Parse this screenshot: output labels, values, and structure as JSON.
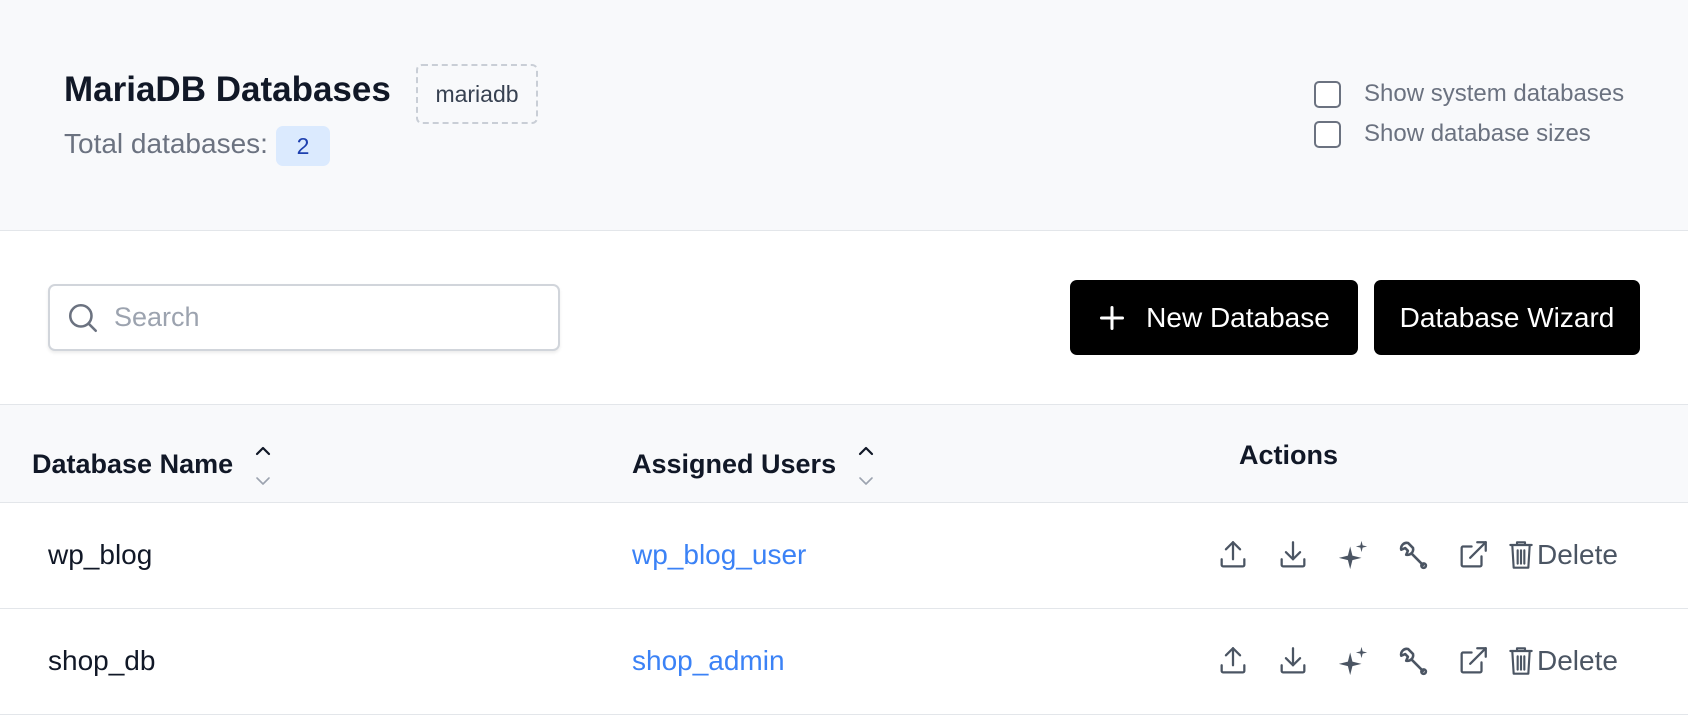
{
  "header": {
    "title": "MariaDB Databases",
    "engine_badge": "mariadb",
    "total_label": "Total databases:",
    "total_count": "2",
    "options": [
      {
        "label": "Show system databases",
        "checked": false
      },
      {
        "label": "Show database sizes",
        "checked": false
      }
    ]
  },
  "toolbar": {
    "search_placeholder": "Search",
    "search_value": "",
    "new_database_label": "New Database",
    "wizard_label": "Database Wizard"
  },
  "table": {
    "columns": [
      "Database Name",
      "Assigned Users",
      "Actions"
    ],
    "rows": [
      {
        "name": "wp_blog",
        "user": "wp_blog_user"
      },
      {
        "name": "shop_db",
        "user": "shop_admin"
      }
    ],
    "delete_label": "Delete"
  },
  "icons": {
    "search": "search-icon",
    "plus": "plus-icon",
    "sort": "sort-icon",
    "upload": "upload-icon",
    "download": "download-icon",
    "sparkles": "sparkles-icon",
    "wrench": "wrench-icon",
    "external_link": "external-link-icon",
    "trash": "trash-icon"
  },
  "colors": {
    "header_bg": "#f8f9fb",
    "badge_bg": "#dbeafe",
    "badge_text": "#1e40af",
    "link": "#3b82f6",
    "button_bg": "#000000",
    "button_text": "#ffffff",
    "icon": "#4b5563"
  }
}
